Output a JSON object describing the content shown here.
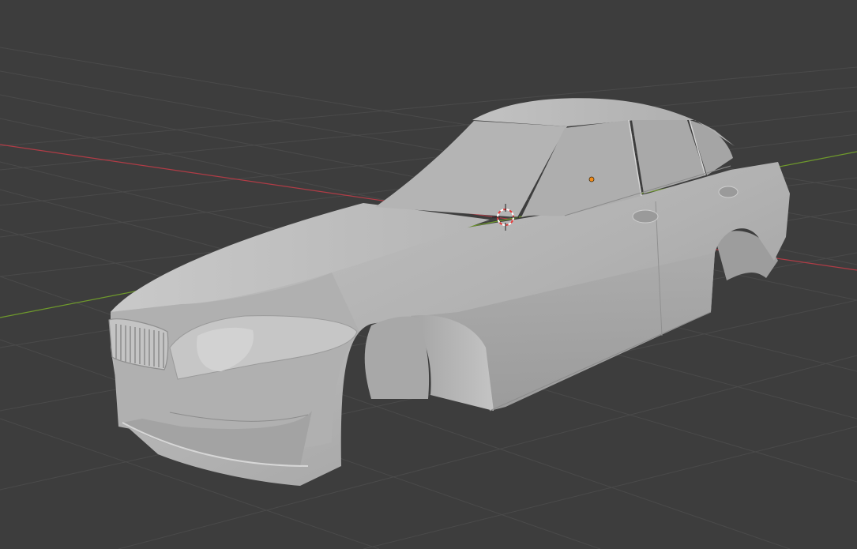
{
  "app": {
    "viewport_background": "#3d3d3d",
    "grid_line_color": "#4a4a4a",
    "x_axis_color": "#b03c46",
    "y_axis_color": "#6f9a2c",
    "model_color": "#b9b9b9",
    "origin_color": "#f28c1a",
    "cursor_ring_color": "#e63b3b"
  },
  "scene": {
    "object_icon": "car-body-mesh",
    "cursor_icon": "3d-cursor-icon",
    "origin_icon": "object-origin-dot-icon"
  }
}
